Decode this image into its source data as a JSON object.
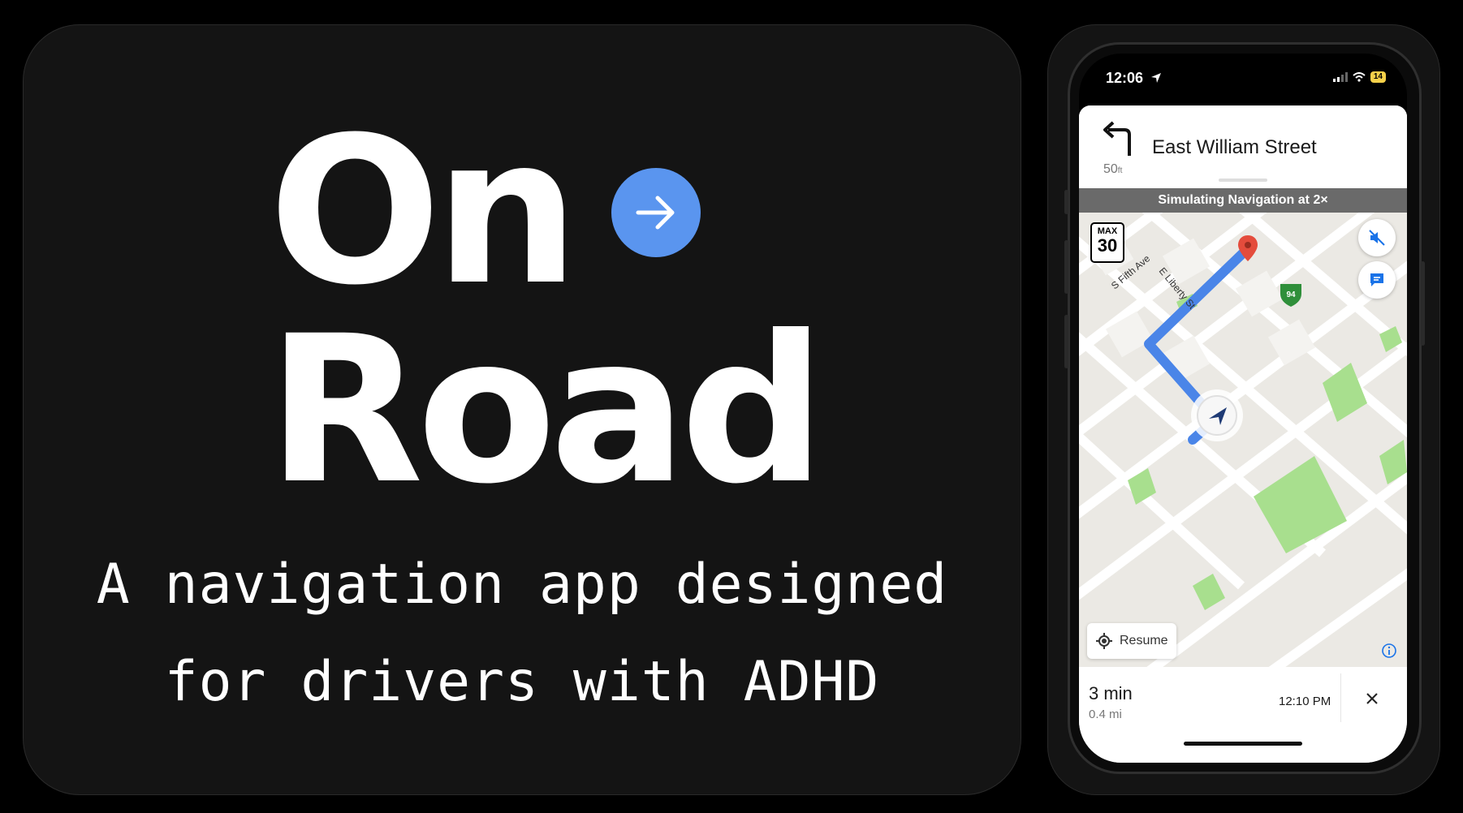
{
  "hero": {
    "title_line1": "On",
    "title_line2": "Road",
    "tagline_line1": "A navigation app designed",
    "tagline_line2": "for drivers with ADHD",
    "arrow_icon": "arrow-right-icon",
    "accent_color": "#5a95ef"
  },
  "status_bar": {
    "time": "12:06",
    "battery": "14"
  },
  "navigation": {
    "street": "East William Street",
    "distance_value": "50",
    "distance_unit": "ft",
    "maneuver_icon": "turn-left-icon",
    "simulation_banner": "Simulating Navigation at 2×"
  },
  "map": {
    "speed_limit_label": "MAX",
    "speed_limit_value": "30",
    "street_labels": [
      "S Fifth Ave",
      "E Liberty St"
    ],
    "highway_shield": "94",
    "resume_label": "Resume",
    "route_color": "#4a85e8"
  },
  "trip": {
    "eta_minutes": "3 min",
    "remaining_distance": "0.4 mi",
    "arrival_time": "12:10 PM"
  }
}
